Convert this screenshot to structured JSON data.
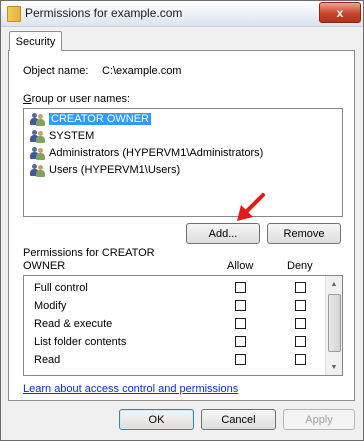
{
  "window": {
    "title": "Permissions for example.com",
    "close_glyph": "x"
  },
  "tab": {
    "label": "Security"
  },
  "object": {
    "label": "Object name:",
    "value": "C:\\example.com"
  },
  "users": {
    "label": "Group or user names:",
    "label_underline_char": "G",
    "label_rest": "roup or user names:",
    "items": [
      {
        "label": "CREATOR OWNER",
        "selected": true,
        "icon": "user-group-icon"
      },
      {
        "label": "SYSTEM",
        "selected": false,
        "icon": "user-group-icon"
      },
      {
        "label": "Administrators (HYPERVM1\\Administrators)",
        "selected": false,
        "icon": "user-group-icon"
      },
      {
        "label": "Users (HYPERVM1\\Users)",
        "selected": false,
        "icon": "user-group-icon"
      }
    ]
  },
  "buttons": {
    "add": "Add...",
    "remove": "Remove",
    "ok": "OK",
    "cancel": "Cancel",
    "apply": "Apply"
  },
  "permissions": {
    "label": "Permissions for CREATOR OWNER",
    "col_allow": "Allow",
    "col_deny": "Deny",
    "rows": [
      {
        "name": "Full control",
        "allow": false,
        "deny": false
      },
      {
        "name": "Modify",
        "allow": false,
        "deny": false
      },
      {
        "name": "Read & execute",
        "allow": false,
        "deny": false
      },
      {
        "name": "List folder contents",
        "allow": false,
        "deny": false
      },
      {
        "name": "Read",
        "allow": false,
        "deny": false
      }
    ]
  },
  "link": {
    "label": "Learn about access control and permissions"
  },
  "colors": {
    "selection": "#3399ff",
    "link": "#0033cc",
    "arrow": "#e01b1b",
    "close_button": "#c9452a"
  }
}
